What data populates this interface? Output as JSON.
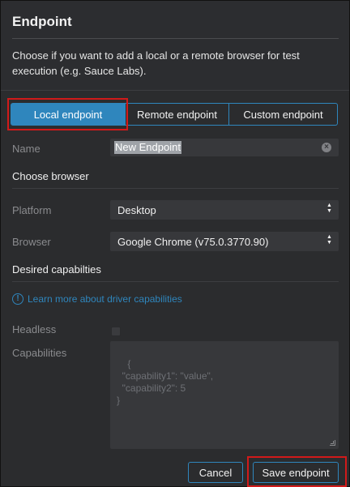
{
  "dialog": {
    "title": "Endpoint",
    "description": "Choose if you want to add a local or a remote browser for test execution (e.g. Sauce Labs)."
  },
  "tabs": [
    {
      "label": "Local endpoint",
      "active": true
    },
    {
      "label": "Remote endpoint",
      "active": false
    },
    {
      "label": "Custom endpoint",
      "active": false
    }
  ],
  "form": {
    "name_label": "Name",
    "name_value": "New Endpoint",
    "choose_browser_heading": "Choose browser",
    "platform_label": "Platform",
    "platform_value": "Desktop",
    "browser_label": "Browser",
    "browser_value": "Google Chrome (v75.0.3770.90)",
    "capabilities_heading": "Desired capabilties",
    "learn_more_link": "Learn more about driver capabilities",
    "headless_label": "Headless",
    "headless_checked": false,
    "capabilities_label": "Capabilities",
    "capabilities_placeholder": "{\n  \"capability1\": \"value\",\n  \"capability2\": 5\n}"
  },
  "footer": {
    "cancel_label": "Cancel",
    "save_label": "Save endpoint"
  },
  "icons": {
    "clear": "clear-circle-icon",
    "select_arrows": "updown-arrows-icon",
    "info": "info-circle-icon",
    "resize": "resize-grip-icon"
  },
  "colors": {
    "accent": "#2f86bd",
    "background": "#2b2c2e",
    "field": "#37383b",
    "highlight": "#d11a1a"
  }
}
